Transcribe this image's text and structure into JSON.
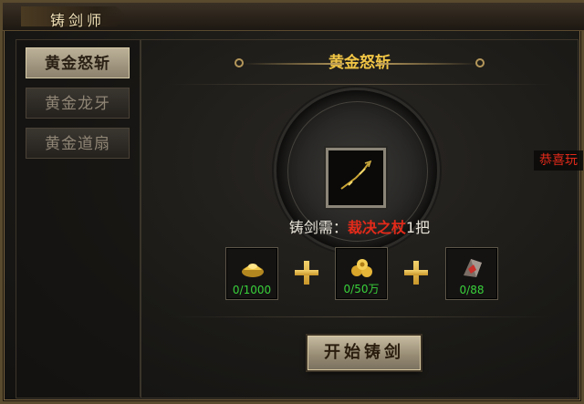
{
  "window": {
    "title": "铸剑师"
  },
  "sidebar": {
    "items": [
      {
        "label": "黄金怒斩",
        "active": true
      },
      {
        "label": "黄金龙牙",
        "active": false
      },
      {
        "label": "黄金道扇",
        "active": false
      }
    ]
  },
  "main": {
    "heading": "黄金怒斩",
    "requirement": {
      "prefix": "铸剑需：",
      "item": "裁决之杖",
      "suffix": "1把"
    },
    "materials": [
      {
        "icon": "gold-ingot-icon",
        "count": "0/1000"
      },
      {
        "icon": "gold-coins-icon",
        "count": "0/50万"
      },
      {
        "icon": "crystal-ore-icon",
        "count": "0/88"
      }
    ],
    "forge_button": "开始铸剑"
  },
  "notice": {
    "text": "恭喜玩"
  },
  "colors": {
    "accent_gold": "#f0c545",
    "item_red": "#e22a1a",
    "count_green": "#39d13a"
  }
}
